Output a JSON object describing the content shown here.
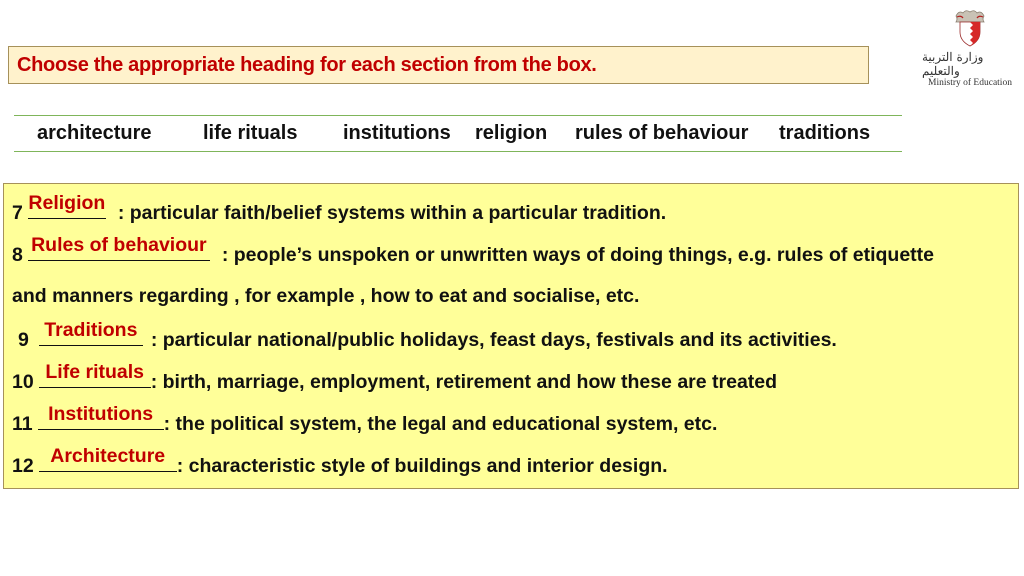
{
  "title": "Choose the appropriate heading for each section from the box.",
  "logo": {
    "arabic": "وزارة التربية والتعليم",
    "english": "Ministry of Education"
  },
  "word_box": [
    "architecture",
    "life rituals",
    "institutions",
    "religion",
    "rules of behaviour",
    "traditions"
  ],
  "items": [
    {
      "number": "7",
      "answer": "Religion",
      "definition": ": particular faith/belief systems within a particular tradition."
    },
    {
      "number": "8",
      "answer": "Rules of behaviour",
      "definition": ": people’s unspoken or unwritten ways of doing things, e.g. rules of etiquette"
    },
    {
      "continuation": "and manners regarding , for example ,  how to eat and socialise,  etc."
    },
    {
      "number": "9",
      "answer": "Traditions",
      "definition": ": particular national/public holidays, feast days, festivals and its activities."
    },
    {
      "number": "10",
      "answer": "Life rituals",
      "definition": ": birth, marriage, employment, retirement and how these are treated"
    },
    {
      "number": "11",
      "answer": "Institutions",
      "definition": ": the political system, the legal and educational system, etc."
    },
    {
      "number": "12",
      "answer": "Architecture",
      "definition": ": characteristic style of buildings and interior design."
    }
  ],
  "colors": {
    "title_text": "#c00000",
    "title_bg": "#fff2cc",
    "answer_text": "#c00000",
    "exercise_bg": "#ffff99",
    "word_box_rule": "#7fb55a"
  }
}
